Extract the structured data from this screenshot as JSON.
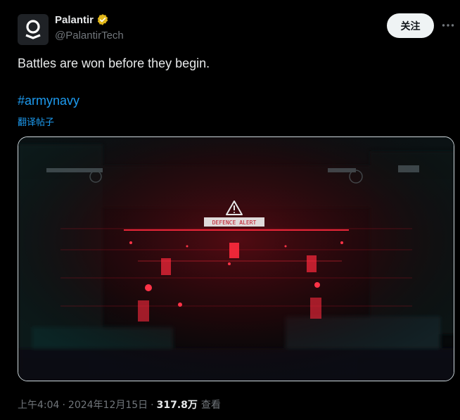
{
  "author": {
    "display_name": "Palantir",
    "handle": "@PalantirTech",
    "verified": true,
    "verified_color": "#e2b719"
  },
  "follow_button": {
    "label": "关注"
  },
  "tweet": {
    "text": "Battles are won before they begin.",
    "hashtag": "#armynavy",
    "translate_label": "翻译帖子"
  },
  "media": {
    "alert_label": "DEFENCE ALERT",
    "accent_color": "#e0142c"
  },
  "meta": {
    "time": "上午4:04",
    "separator": "·",
    "date": "2024年12月15日",
    "views_count": "317.8万",
    "views_label": "查看"
  },
  "icons": {
    "avatar": "palantir-logo-icon",
    "verified": "verified-badge-icon",
    "more": "more-dots-icon",
    "alert": "warning-triangle-icon"
  }
}
